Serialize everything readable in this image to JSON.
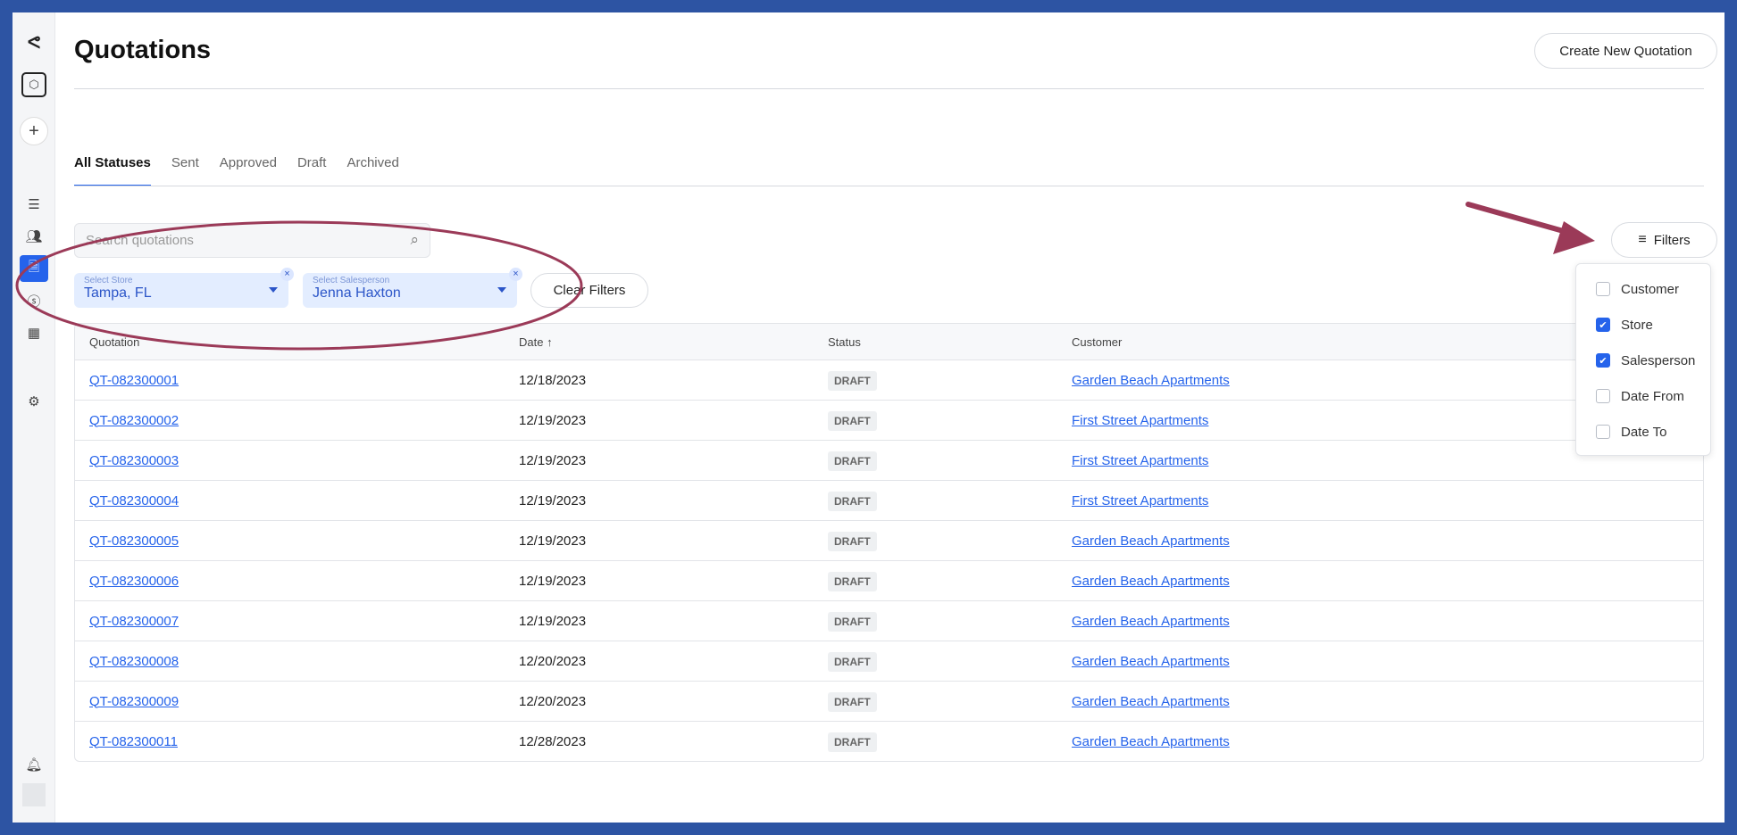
{
  "sidebar": {
    "items": [
      {
        "icon": "logo-icon"
      },
      {
        "icon": "tag-icon"
      },
      {
        "icon": "plus-icon"
      },
      {
        "icon": "list-icon"
      },
      {
        "icon": "users-icon"
      },
      {
        "icon": "document-icon",
        "active": true
      },
      {
        "icon": "dollar-icon"
      },
      {
        "icon": "grid-icon"
      },
      {
        "icon": "gear-icon"
      },
      {
        "icon": "bell-icon"
      },
      {
        "icon": "avatar-icon"
      }
    ]
  },
  "header": {
    "title": "Quotations",
    "create_label": "Create New Quotation"
  },
  "tabs": [
    "All Statuses",
    "Sent",
    "Approved",
    "Draft",
    "Archived"
  ],
  "search": {
    "placeholder": "Search quotations"
  },
  "filters": {
    "store_label": "Select Store",
    "store_value": "Tampa, FL",
    "salesperson_label": "Select Salesperson",
    "salesperson_value": "Jenna Haxton",
    "clear_label": "Clear Filters",
    "button_label": "Filters",
    "options": [
      {
        "label": "Customer",
        "checked": false
      },
      {
        "label": "Store",
        "checked": true
      },
      {
        "label": "Salesperson",
        "checked": true
      },
      {
        "label": "Date From",
        "checked": false
      },
      {
        "label": "Date To",
        "checked": false
      }
    ]
  },
  "table": {
    "columns": [
      "Quotation",
      "Date ↑",
      "Status",
      "Customer"
    ],
    "rows": [
      [
        "QT-082300001",
        "12/18/2023",
        "DRAFT",
        "Garden Beach Apartments"
      ],
      [
        "QT-082300002",
        "12/19/2023",
        "DRAFT",
        "First Street Apartments"
      ],
      [
        "QT-082300003",
        "12/19/2023",
        "DRAFT",
        "First Street Apartments"
      ],
      [
        "QT-082300004",
        "12/19/2023",
        "DRAFT",
        "First Street Apartments"
      ],
      [
        "QT-082300005",
        "12/19/2023",
        "DRAFT",
        "Garden Beach Apartments"
      ],
      [
        "QT-082300006",
        "12/19/2023",
        "DRAFT",
        "Garden Beach Apartments"
      ],
      [
        "QT-082300007",
        "12/19/2023",
        "DRAFT",
        "Garden Beach Apartments"
      ],
      [
        "QT-082300008",
        "12/20/2023",
        "DRAFT",
        "Garden Beach Apartments"
      ],
      [
        "QT-082300009",
        "12/20/2023",
        "DRAFT",
        "Garden Beach Apartments"
      ],
      [
        "QT-082300011",
        "12/28/2023",
        "DRAFT",
        "Garden Beach Apartments"
      ]
    ]
  },
  "colors": {
    "accent": "#2563eb",
    "annotation": "#9b3a58",
    "frame": "#2d54a3"
  }
}
